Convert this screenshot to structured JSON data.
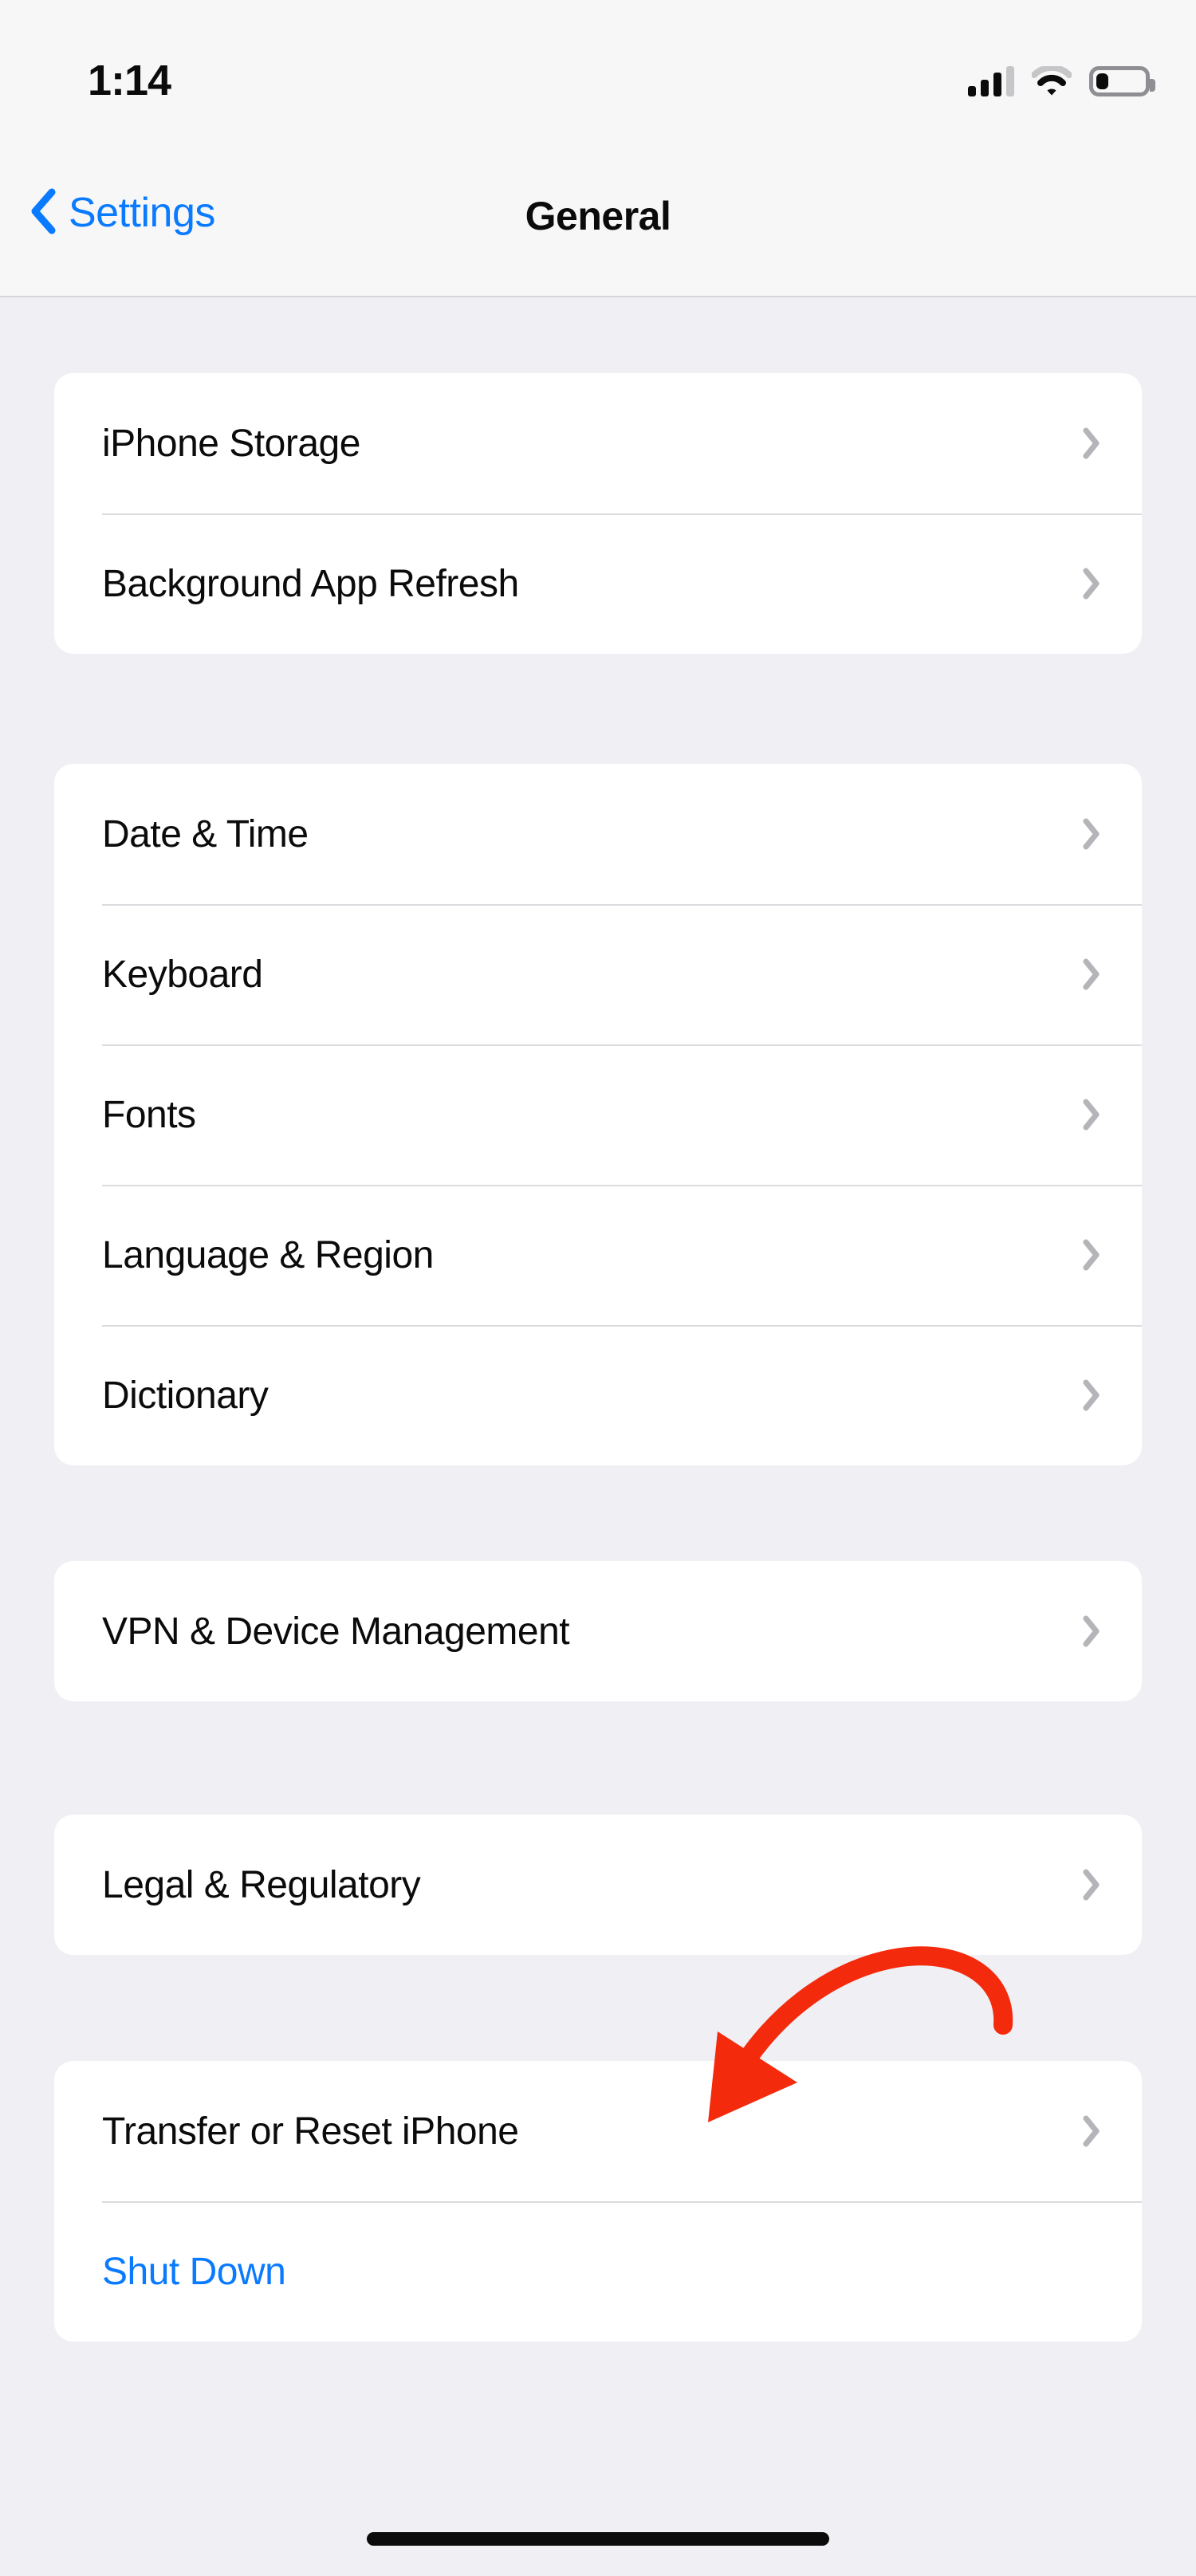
{
  "status_bar": {
    "time": "1:14",
    "cellular_icon": "cellular-signal-icon",
    "cellular_bars_total": 4,
    "cellular_bars_filled": 3,
    "wifi_icon": "wifi-icon",
    "wifi_arcs_total": 3,
    "wifi_arcs_filled": 2,
    "battery_icon": "battery-icon",
    "battery_level_percent": 25
  },
  "nav_bar": {
    "back_icon": "chevron-left-icon",
    "back_label": "Settings",
    "title": "General"
  },
  "groups": [
    {
      "id": "storage-group",
      "rows": [
        {
          "label": "iPhone Storage",
          "accessory": "chevron-right-icon",
          "style": "default"
        },
        {
          "label": "Background App Refresh",
          "accessory": "chevron-right-icon",
          "style": "default"
        }
      ]
    },
    {
      "id": "localization-group",
      "rows": [
        {
          "label": "Date & Time",
          "accessory": "chevron-right-icon",
          "style": "default"
        },
        {
          "label": "Keyboard",
          "accessory": "chevron-right-icon",
          "style": "default"
        },
        {
          "label": "Fonts",
          "accessory": "chevron-right-icon",
          "style": "default"
        },
        {
          "label": "Language & Region",
          "accessory": "chevron-right-icon",
          "style": "default"
        },
        {
          "label": "Dictionary",
          "accessory": "chevron-right-icon",
          "style": "default"
        }
      ]
    },
    {
      "id": "vpn-group",
      "rows": [
        {
          "label": "VPN & Device Management",
          "accessory": "chevron-right-icon",
          "style": "default"
        }
      ]
    },
    {
      "id": "legal-group",
      "rows": [
        {
          "label": "Legal & Regulatory",
          "accessory": "chevron-right-icon",
          "style": "default"
        }
      ]
    },
    {
      "id": "reset-group",
      "rows": [
        {
          "label": "Transfer or Reset iPhone",
          "accessory": "chevron-right-icon",
          "style": "default"
        },
        {
          "label": "Shut Down",
          "accessory": "none",
          "style": "accent"
        }
      ]
    }
  ],
  "annotation": {
    "type": "curved-arrow",
    "color": "#F42A0C",
    "points_to": "Transfer or Reset iPhone"
  },
  "colors": {
    "accent_blue": "#0A7AFF",
    "page_background": "#EFEFF4",
    "card_background": "#FFFFFF",
    "bar_background": "#F7F7F8",
    "separator": "#DCDCE0",
    "chevron_gray": "#B4B4B9",
    "annotation_red": "#F42A0C"
  },
  "home_indicator": "home-indicator"
}
